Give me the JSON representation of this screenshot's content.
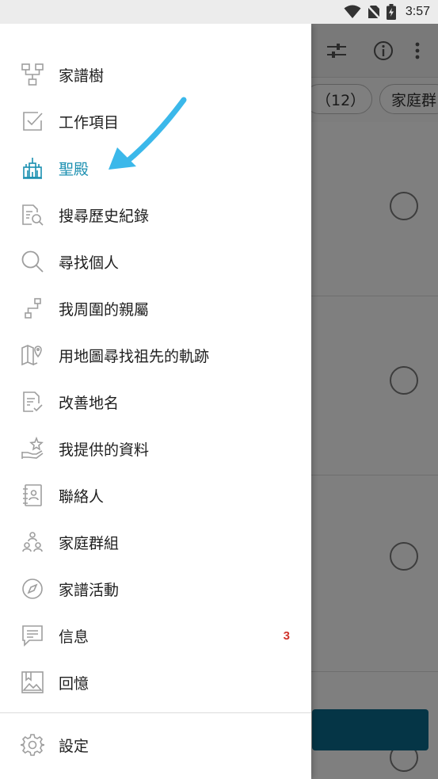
{
  "status_bar": {
    "time": "3:57",
    "icons": [
      "wifi-icon",
      "no-sim-icon",
      "battery-charging-icon"
    ]
  },
  "background": {
    "toolbar_icons": [
      "filter-sliders-icon",
      "info-icon",
      "more-vert-icon"
    ],
    "chips": [
      "（12）",
      "家庭群"
    ]
  },
  "drawer": {
    "items": [
      {
        "label": "家譜樹",
        "icon": "family-tree-icon",
        "active": false
      },
      {
        "label": "工作項目",
        "icon": "task-check-icon",
        "active": false
      },
      {
        "label": "聖殿",
        "icon": "temple-icon",
        "active": true
      },
      {
        "label": "搜尋歷史紀錄",
        "icon": "record-search-icon",
        "active": false
      },
      {
        "label": "尋找個人",
        "icon": "search-icon",
        "active": false
      },
      {
        "label": "我周圍的親屬",
        "icon": "relatives-nearby-icon",
        "active": false
      },
      {
        "label": "用地圖尋找祖先的軌跡",
        "icon": "map-pin-icon",
        "active": false
      },
      {
        "label": "改善地名",
        "icon": "place-document-icon",
        "active": false
      },
      {
        "label": "我提供的資料",
        "icon": "hand-star-icon",
        "active": false
      },
      {
        "label": "聯絡人",
        "icon": "contacts-book-icon",
        "active": false
      },
      {
        "label": "家庭群組",
        "icon": "family-group-icon",
        "active": false
      },
      {
        "label": "家譜活動",
        "icon": "compass-icon",
        "active": false
      },
      {
        "label": "信息",
        "icon": "message-icon",
        "active": false,
        "badge": "3"
      },
      {
        "label": "回憶",
        "icon": "memories-photo-icon",
        "active": false
      }
    ],
    "settings": {
      "label": "設定",
      "icon": "gear-icon"
    }
  },
  "colors": {
    "accent": "#1a8fb0",
    "icon_gray": "#9e9e9e",
    "badge_red": "#d0342c",
    "annotation_arrow": "#3bb8ea"
  }
}
